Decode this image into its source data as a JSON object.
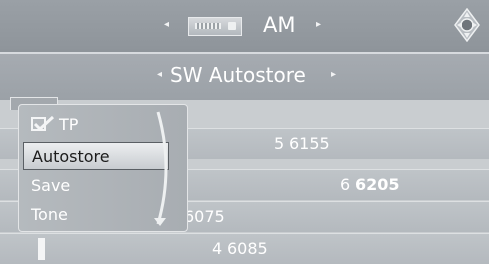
{
  "header": {
    "source_label": "AM",
    "left_arrow": "◂",
    "right_arrow": "▸",
    "icons": [
      "radio-icon",
      "navigation-controller-icon"
    ]
  },
  "subheader": {
    "title": "SW Autostore",
    "left_arrow": "◂",
    "right_arrow": "▸"
  },
  "popup_menu": {
    "items": [
      {
        "label": "TP",
        "checked": true
      },
      {
        "label": "Autostore",
        "selected": true
      },
      {
        "label": "Save"
      },
      {
        "label": "Tone"
      }
    ]
  },
  "station_list": [
    {
      "preset": "5",
      "frequency": "6155"
    },
    {
      "preset": "6",
      "frequency": "6205"
    },
    {
      "preset": "",
      "frequency": "6075"
    },
    {
      "preset": "4",
      "frequency": "6085"
    }
  ],
  "colors": {
    "text": "#ffffff",
    "selection_bg": "#e6e8ea",
    "panel": "#9aa0a6"
  }
}
